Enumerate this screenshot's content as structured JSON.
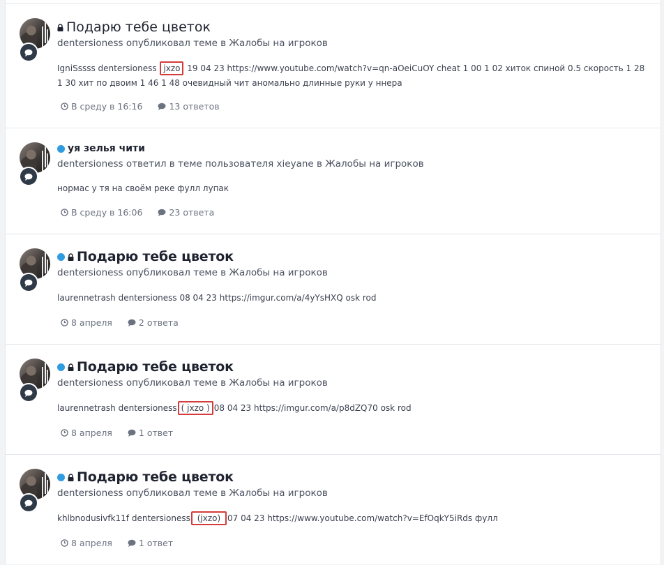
{
  "items": [
    {
      "title": "Подарю тебе цветок",
      "meta": "dentersioness опубликовал теме в Жалобы на игроков",
      "snippet_before": "IgniSssss dentersioness ",
      "snippet_highlight": "jxzo",
      "snippet_after": " 19 04 23 https://www.youtube.com/watch?v=qn-aOeiCuOY cheat 1 00 1 02 хиток спиной 0.5 скорость 1 28 1 30 хит по двоим 1 46 1 48 очевидный чит аномально длинные руки у ннера",
      "date": "В среду в 16:16",
      "replies": "13 ответов"
    },
    {
      "title": "уя зелья чити",
      "meta": "dentersioness ответил в теме пользователя xieyane в Жалобы на игроков",
      "snippet_before": "нормас у тя на своём реке фулл лупак",
      "snippet_highlight": "",
      "snippet_after": "",
      "date": "В среду в 16:06",
      "replies": "23 ответа"
    },
    {
      "title": "Подарю тебе цветок",
      "meta": "dentersioness опубликовал теме в Жалобы на игроков",
      "snippet_before": "laurennetrash dentersioness 08 04 23 https://imgur.com/a/4yYsHXQ osk rod",
      "snippet_highlight": "",
      "snippet_after": "",
      "date": "8 апреля",
      "replies": "2 ответа"
    },
    {
      "title": "Подарю тебе цветок",
      "meta": "dentersioness опубликовал теме в Жалобы на игроков",
      "snippet_before": "laurennetrash dentersioness",
      "snippet_highlight": "( jxzo )",
      "snippet_after": "08 04 23 https://imgur.com/a/p8dZQ70 osk rod",
      "date": "8 апреля",
      "replies": "1 ответ"
    },
    {
      "title": "Подарю тебе цветок",
      "meta": "dentersioness опубликовал теме в Жалобы на игроков",
      "snippet_before": "khlbnodusivfk11f dentersioness",
      "snippet_highlight": " (jxzo) ",
      "snippet_after": "07 04 23 https://www.youtube.com/watch?v=EfOqkY5iRds фулл",
      "date": "8 апреля",
      "replies": "1 ответ"
    }
  ],
  "colors": {
    "unread_dot": "#2f9ce0",
    "highlight_box": "#d43b3b",
    "badge": "#2f3a48"
  },
  "icons": [
    "lock-icon",
    "unread-dot",
    "comment-icon",
    "clock-icon",
    "comments-icon"
  ]
}
